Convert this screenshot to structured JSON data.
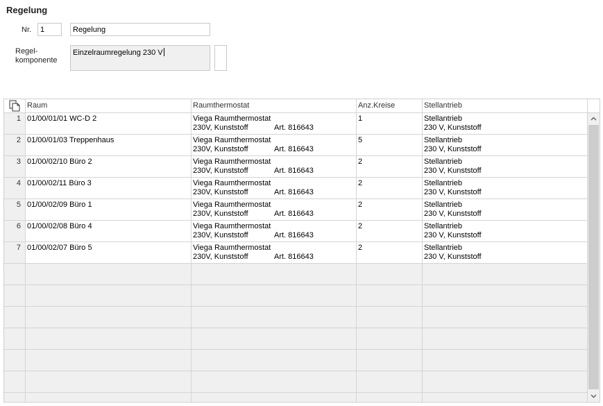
{
  "section": {
    "title": "Regelung"
  },
  "form": {
    "nr_label": "Nr.",
    "nr_value": "1",
    "name_value": "Regelung",
    "komponente_label_line1": "Regel-",
    "komponente_label_line2": "komponente",
    "komponente_value": "Einzelraumregelung 230 V"
  },
  "table": {
    "copy_icon": "copy-icon",
    "columns": [
      "Raum",
      "Raumthermostat",
      "Anz.Kreise",
      "Stellantrieb"
    ],
    "rows": [
      {
        "nr": "1",
        "raum": "01/00/01/01 WC-D 2",
        "thermo1": "Viega Raumthermostat",
        "thermo2": "230V, Kunststoff",
        "art": "Art. 816643",
        "kreise": "1",
        "stell1": "Stellantrieb",
        "stell2": "230 V, Kunststoff"
      },
      {
        "nr": "2",
        "raum": "01/00/01/03 Treppenhaus",
        "thermo1": "Viega Raumthermostat",
        "thermo2": "230V, Kunststoff",
        "art": "Art. 816643",
        "kreise": "5",
        "stell1": "Stellantrieb",
        "stell2": "230 V, Kunststoff"
      },
      {
        "nr": "3",
        "raum": "01/00/02/10 Büro 2",
        "thermo1": "Viega Raumthermostat",
        "thermo2": "230V, Kunststoff",
        "art": "Art. 816643",
        "kreise": "2",
        "stell1": "Stellantrieb",
        "stell2": "230 V, Kunststoff"
      },
      {
        "nr": "4",
        "raum": "01/00/02/11 Büro 3",
        "thermo1": "Viega Raumthermostat",
        "thermo2": "230V, Kunststoff",
        "art": "Art. 816643",
        "kreise": "2",
        "stell1": "Stellantrieb",
        "stell2": "230 V, Kunststoff"
      },
      {
        "nr": "5",
        "raum": "01/00/02/09 Büro 1",
        "thermo1": "Viega Raumthermostat",
        "thermo2": "230V, Kunststoff",
        "art": "Art. 816643",
        "kreise": "2",
        "stell1": "Stellantrieb",
        "stell2": "230 V, Kunststoff"
      },
      {
        "nr": "6",
        "raum": "01/00/02/08 Büro 4",
        "thermo1": "Viega Raumthermostat",
        "thermo2": "230V, Kunststoff",
        "art": "Art. 816643",
        "kreise": "2",
        "stell1": "Stellantrieb",
        "stell2": "230 V, Kunststoff"
      },
      {
        "nr": "7",
        "raum": "01/00/02/07 Büro 5",
        "thermo1": "Viega Raumthermostat",
        "thermo2": "230V, Kunststoff",
        "art": "Art. 816643",
        "kreise": "2",
        "stell1": "Stellantrieb",
        "stell2": "230 V, Kunststoff"
      }
    ]
  },
  "scrollbar": {
    "up_icon": "chevron-up-icon",
    "down_icon": "chevron-down-icon"
  }
}
